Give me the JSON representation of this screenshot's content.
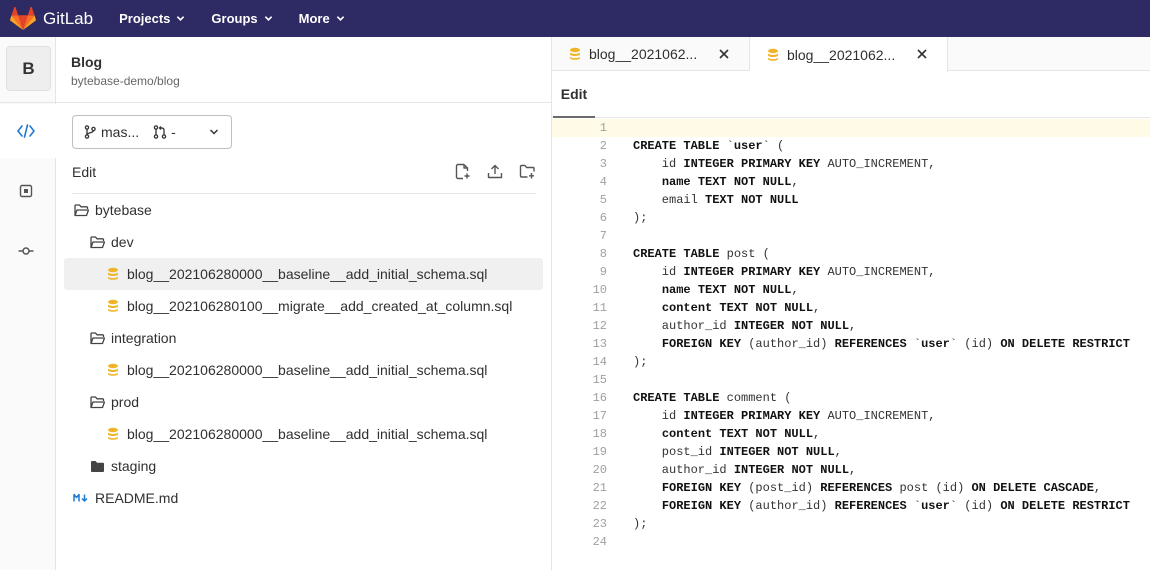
{
  "navbar": {
    "brand": "GitLab",
    "items": [
      "Projects",
      "Groups",
      "More"
    ]
  },
  "rail": {
    "avatar_letter": "B"
  },
  "project": {
    "name": "Blog",
    "path": "bytebase-demo/blog"
  },
  "branch": {
    "name": "mas...",
    "mr": "-"
  },
  "tree": {
    "header": "Edit",
    "items": [
      {
        "label": "bytebase",
        "type": "folder"
      },
      {
        "label": "dev",
        "type": "folder"
      },
      {
        "label": "blog__202106280000__baseline__add_initial_schema.sql",
        "type": "sql"
      },
      {
        "label": "blog__202106280100__migrate__add_created_at_column.sql",
        "type": "sql"
      },
      {
        "label": "integration",
        "type": "folder"
      },
      {
        "label": "blog__202106280000__baseline__add_initial_schema.sql",
        "type": "sql"
      },
      {
        "label": "prod",
        "type": "folder"
      },
      {
        "label": "blog__202106280000__baseline__add_initial_schema.sql",
        "type": "sql"
      },
      {
        "label": "staging",
        "type": "folder-closed"
      },
      {
        "label": "README.md",
        "type": "markdown"
      }
    ]
  },
  "editor": {
    "tabs": [
      "blog__2021062...",
      "blog__2021062..."
    ],
    "mode_tab": "Edit",
    "line_numbers": [
      "1",
      "2",
      "3",
      "4",
      "5",
      "6",
      "7",
      "8",
      "9",
      "10",
      "11",
      "12",
      "13",
      "14",
      "15",
      "16",
      "17",
      "18",
      "19",
      "20",
      "21",
      "22",
      "23",
      "24"
    ]
  },
  "colors": {
    "navbar_bg": "#2e2a63",
    "sql_icon": "#f0b429",
    "markdown_icon": "#1f78d1"
  }
}
